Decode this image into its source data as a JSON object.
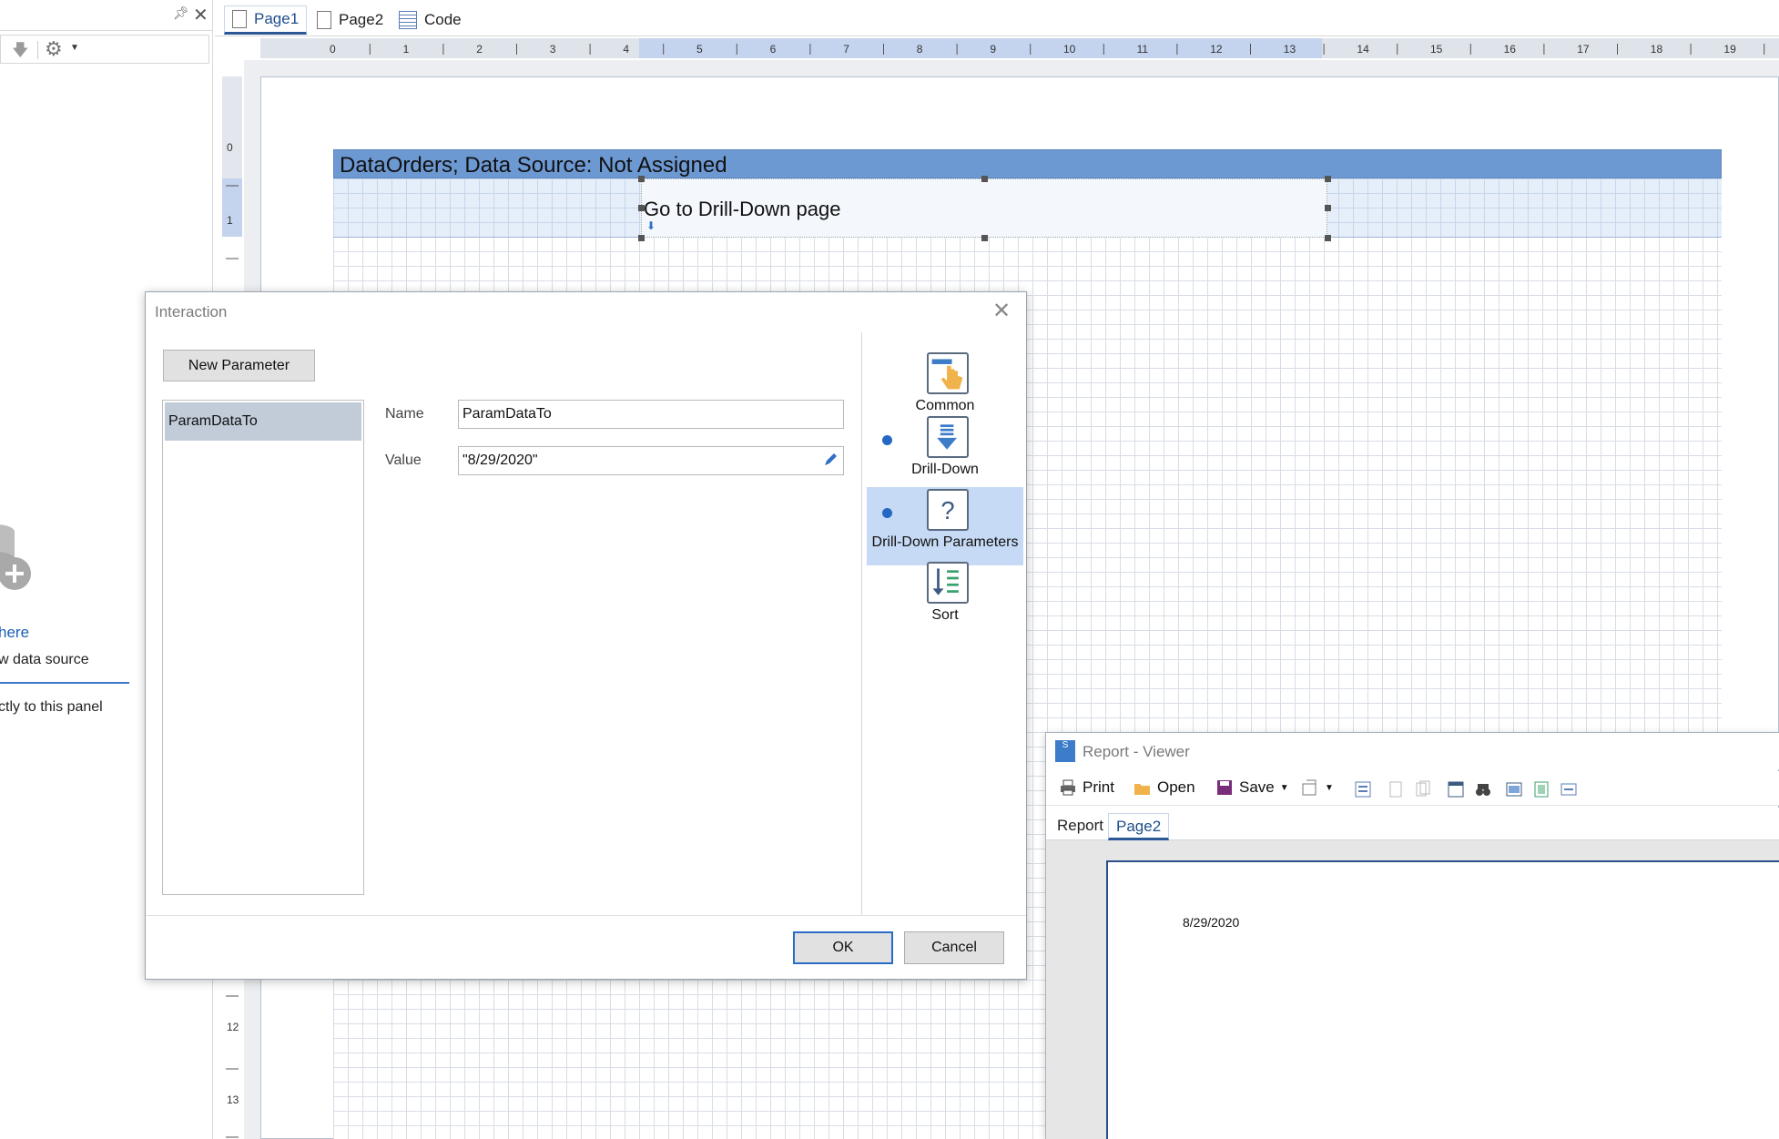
{
  "left_panel": {
    "link_text": "here",
    "desc_text": "w data source",
    "desc2_text": "ctly to this panel"
  },
  "designer": {
    "tabs": [
      {
        "label": "Page1",
        "active": true
      },
      {
        "label": "Page2",
        "active": false
      },
      {
        "label": "Code",
        "active": false
      }
    ],
    "ruler_h": [
      "0",
      "1",
      "2",
      "3",
      "4",
      "5",
      "6",
      "7",
      "8",
      "9",
      "10",
      "11",
      "12",
      "13",
      "14",
      "15",
      "16",
      "17",
      "18",
      "19"
    ],
    "ruler_v": [
      "0",
      "1",
      "12",
      "13"
    ],
    "band_title": "DataOrders; Data Source: Not Assigned",
    "textbox_text": "Go to Drill-Down page"
  },
  "dialog": {
    "title": "Interaction",
    "new_param_label": "New Parameter",
    "params": [
      "ParamDataTo"
    ],
    "name_label": "Name",
    "name_value": "ParamDataTo",
    "value_label": "Value",
    "value_value": "\"8/29/2020\"",
    "categories": [
      {
        "label": "Common",
        "icon": "hand-pointer-icon",
        "dot": false,
        "selected": false
      },
      {
        "label": "Drill-Down",
        "icon": "drill-down-arrow-icon",
        "dot": true,
        "selected": false
      },
      {
        "label": "Drill-Down Parameters",
        "icon": "question-mark-icon",
        "dot": true,
        "selected": true
      },
      {
        "label": "Sort",
        "icon": "sort-icon",
        "dot": false,
        "selected": false
      }
    ],
    "ok_label": "OK",
    "cancel_label": "Cancel"
  },
  "viewer": {
    "title": "Report - Viewer",
    "toolbar": {
      "print": "Print",
      "open": "Open",
      "save": "Save"
    },
    "tabs": [
      {
        "label": "Report",
        "active": false
      },
      {
        "label": "Page2",
        "active": true
      }
    ],
    "page_date": "8/29/2020"
  },
  "colors": {
    "band_header": "#6d99d3",
    "band_body": "#e6eef9",
    "accent": "#2b5797",
    "selected_category": "#c6d9f5"
  }
}
